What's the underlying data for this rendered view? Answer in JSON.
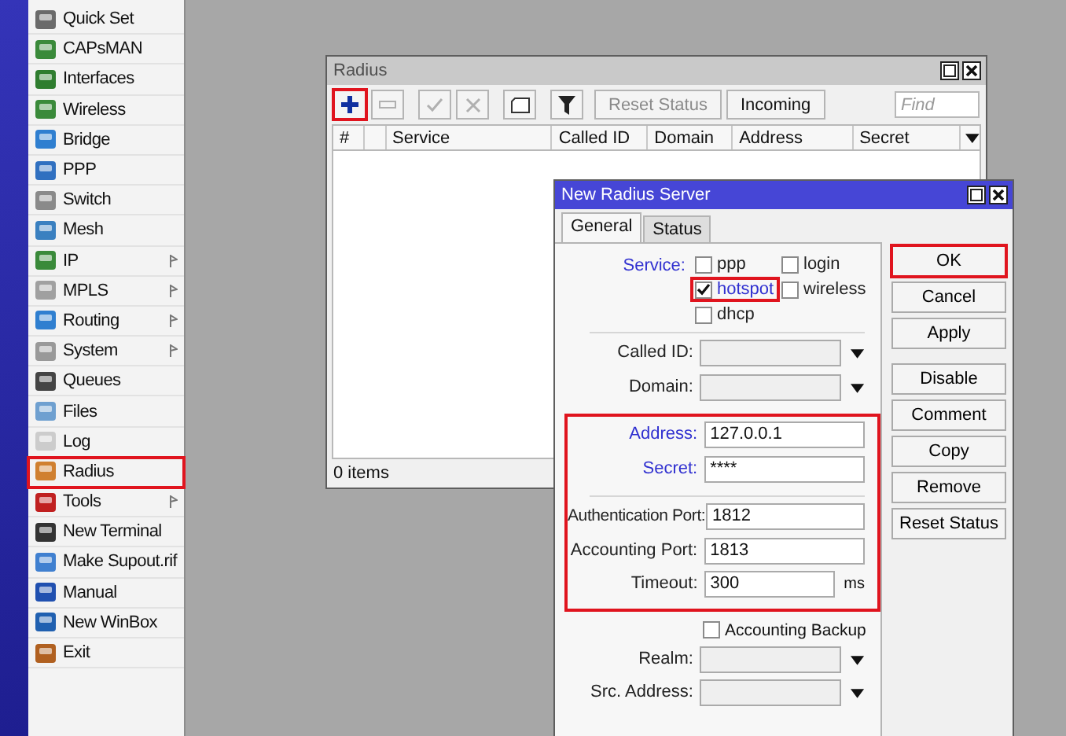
{
  "menu": {
    "items": [
      {
        "label": "Quick Set",
        "submenu": false,
        "highlighted": false
      },
      {
        "label": "CAPsMAN",
        "submenu": false,
        "highlighted": false
      },
      {
        "label": "Interfaces",
        "submenu": false,
        "highlighted": false
      },
      {
        "label": "Wireless",
        "submenu": false,
        "highlighted": false
      },
      {
        "label": "Bridge",
        "submenu": false,
        "highlighted": false
      },
      {
        "label": "PPP",
        "submenu": false,
        "highlighted": false
      },
      {
        "label": "Switch",
        "submenu": false,
        "highlighted": false
      },
      {
        "label": "Mesh",
        "submenu": false,
        "highlighted": false
      },
      {
        "label": "IP",
        "submenu": true,
        "highlighted": false
      },
      {
        "label": "MPLS",
        "submenu": true,
        "highlighted": false
      },
      {
        "label": "Routing",
        "submenu": true,
        "highlighted": false
      },
      {
        "label": "System",
        "submenu": true,
        "highlighted": false
      },
      {
        "label": "Queues",
        "submenu": false,
        "highlighted": false
      },
      {
        "label": "Files",
        "submenu": false,
        "highlighted": false
      },
      {
        "label": "Log",
        "submenu": false,
        "highlighted": false
      },
      {
        "label": "Radius",
        "submenu": false,
        "highlighted": true
      },
      {
        "label": "Tools",
        "submenu": true,
        "highlighted": false
      },
      {
        "label": "New Terminal",
        "submenu": false,
        "highlighted": false
      },
      {
        "label": "Make Supout.rif",
        "submenu": false,
        "highlighted": false
      },
      {
        "label": "Manual",
        "submenu": false,
        "highlighted": false
      },
      {
        "label": "New WinBox",
        "submenu": false,
        "highlighted": false
      },
      {
        "label": "Exit",
        "submenu": false,
        "highlighted": false
      }
    ]
  },
  "radius_window": {
    "title": "Radius",
    "toolbar": [
      {
        "kind": "add",
        "disabled": false,
        "highlighted": true
      },
      {
        "kind": "remove",
        "disabled": true,
        "highlighted": false
      },
      {
        "kind": "enable",
        "disabled": true,
        "highlighted": false
      },
      {
        "kind": "disable",
        "disabled": true,
        "highlighted": false
      },
      {
        "kind": "comment",
        "disabled": false,
        "highlighted": false
      },
      {
        "kind": "filter",
        "disabled": false,
        "highlighted": false
      },
      {
        "kind": "text",
        "label": "Reset Status",
        "disabled": true,
        "highlighted": false
      },
      {
        "kind": "text",
        "label": "Incoming",
        "disabled": false,
        "highlighted": false
      }
    ],
    "find": {
      "placeholder": "Find"
    },
    "columns": [
      "#",
      "",
      "Service",
      "Called ID",
      "Domain",
      "Address",
      "Secret"
    ],
    "status": "0 items"
  },
  "dialog": {
    "title": "New Radius Server",
    "tabs": [
      {
        "label": "General",
        "selected": true
      },
      {
        "label": "Status",
        "selected": false
      }
    ],
    "blocks": [
      {
        "highlighted": false,
        "sections": [
          [
            {
              "kind": "checkgroup",
              "label": "Service:",
              "changed": true,
              "options": [
                {
                  "label": "ppp",
                  "checked": false,
                  "highlighted": false
                },
                {
                  "label": "login",
                  "checked": false,
                  "highlighted": false
                },
                {
                  "label": "hotspot",
                  "checked": true,
                  "highlighted": true
                },
                {
                  "label": "wireless",
                  "checked": false,
                  "highlighted": false
                },
                {
                  "label": "dhcp",
                  "checked": false,
                  "highlighted": false
                }
              ]
            }
          ],
          [
            {
              "kind": "combo",
              "label": "Called ID:",
              "changed": false
            },
            {
              "kind": "combo",
              "label": "Domain:",
              "changed": false
            }
          ]
        ]
      },
      {
        "highlighted": true,
        "sections": [
          [
            {
              "kind": "text",
              "label": "Address:",
              "value": "127.0.0.1",
              "changed": true
            },
            {
              "kind": "text",
              "label": "Secret:",
              "value": "****",
              "changed": true
            }
          ],
          [
            {
              "kind": "text",
              "label": "Authentication Port:",
              "value": "1812",
              "changed": false
            },
            {
              "kind": "text",
              "label": "Accounting Port:",
              "value": "1813",
              "changed": false
            },
            {
              "kind": "text",
              "label": "Timeout:",
              "value": "300",
              "unit": "ms",
              "changed": false
            }
          ]
        ]
      },
      {
        "highlighted": false,
        "sections": [
          [
            {
              "kind": "checkbox",
              "label": "Accounting Backup",
              "checked": false
            },
            {
              "kind": "combo",
              "label": "Realm:",
              "changed": false
            },
            {
              "kind": "combo",
              "label": "Src. Address:",
              "changed": false
            }
          ]
        ]
      }
    ],
    "buttons": [
      {
        "label": "OK",
        "highlighted": true
      },
      {
        "label": "Cancel",
        "highlighted": false
      },
      {
        "label": "Apply",
        "highlighted": false
      },
      {
        "label": "Disable",
        "highlighted": false
      },
      {
        "label": "Comment",
        "highlighted": false
      },
      {
        "label": "Copy",
        "highlighted": false
      },
      {
        "label": "Remove",
        "highlighted": false
      },
      {
        "label": "Reset Status",
        "highlighted": false
      }
    ]
  }
}
